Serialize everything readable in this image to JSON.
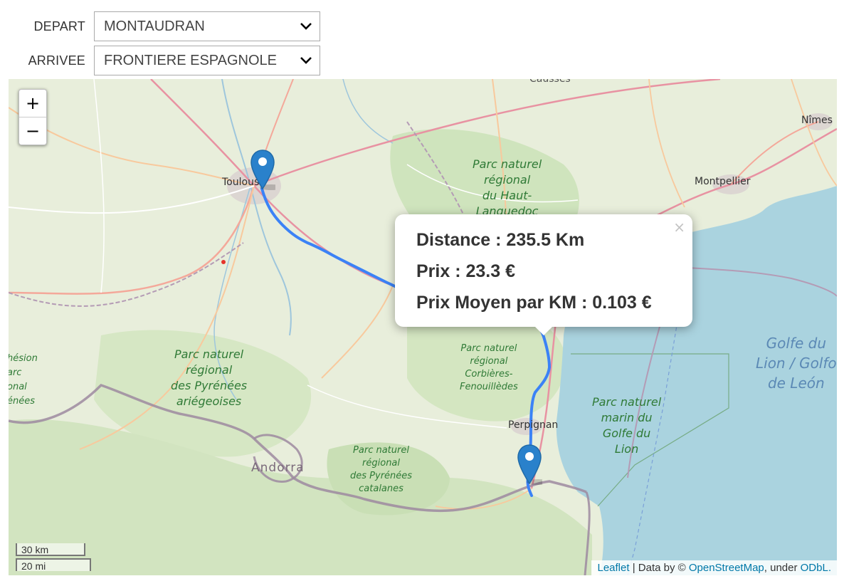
{
  "form": {
    "depart": {
      "label": "DEPART",
      "value": "MONTAUDRAN"
    },
    "arrivee": {
      "label": "ARRIVEE",
      "value": "FRONTIERE ESPAGNOLE"
    }
  },
  "map": {
    "zoom_in": "+",
    "zoom_out": "−",
    "cities": {
      "toulouse": "Toulouse",
      "montpellier": "Montpellier",
      "nimes": "Nîmes",
      "perpignan": "Perpignan",
      "andorra": "Andorra",
      "causses": "Causses"
    },
    "parks": {
      "haut_languedoc": [
        "Parc naturel",
        "régional",
        "du Haut-",
        "Languedoc"
      ],
      "pyrenees_ariegeoises": [
        "Parc naturel",
        "régional",
        "des Pyrénées",
        "ariégeoises"
      ],
      "corbieres": [
        "Parc naturel",
        "régional",
        "Corbières-",
        "Fenouillèdes"
      ],
      "pyrenees_catalanes": [
        "Parc naturel",
        "régional",
        "des Pyrénées",
        "catalanes"
      ],
      "golfe_du_lion": [
        "Parc naturel",
        "marin du",
        "Golfe du",
        "Lion"
      ],
      "left_edge": [
        "hésion",
        "arc",
        "onal",
        "énées"
      ]
    },
    "sea": [
      "Golfe du",
      "Lion / Golfo",
      "de León"
    ],
    "popup": {
      "close": "×",
      "distance": "Distance : 235.5 Km",
      "prix": "Prix : 23.3 €",
      "prix_moyen": "Prix Moyen par KM : 0.103 €"
    },
    "scale": {
      "km": "30 km",
      "mi": "20 mi"
    },
    "attribution": {
      "leaflet": "Leaflet",
      "data_by": " | Data by © ",
      "osm": "OpenStreetMap",
      "under": ", under ",
      "odbl": "ODbL."
    },
    "colors": {
      "route": "#3b82f6",
      "marker": "#2a81cb",
      "sea": "#aad3df",
      "border": "#9e8aa0"
    }
  }
}
